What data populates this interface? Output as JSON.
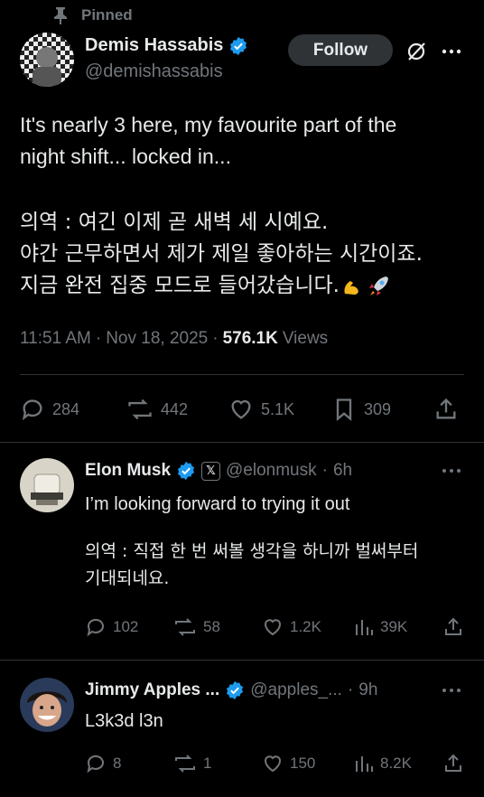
{
  "pinned": {
    "label": "Pinned"
  },
  "main_post": {
    "author_name": "Demis Hassabis",
    "author_handle": "@demishassabis",
    "follow_label": "Follow",
    "text_lines": [
      "It's nearly 3 here, my favourite part of the",
      "night shift... locked in..."
    ],
    "translation_lines": [
      "의역 : 여긴 이제 곧 새벽 세 시예요.",
      "야간 근무하면서 제가 제일 좋아하는 시간이죠.",
      "지금 완전 집중 모드로 들어갔습니다."
    ],
    "time": "11:51 AM",
    "date": "Nov 18, 2025",
    "views_count": "576.1K",
    "views_label": "Views",
    "replies": "284",
    "reposts": "442",
    "likes": "5.1K",
    "bookmarks": "309"
  },
  "replies": [
    {
      "author_name": "Elon Musk",
      "author_handle": "@elonmusk",
      "age": "6h",
      "text": "I’m looking forward to trying it out",
      "translation_lines": [
        "의역 : 직접 한 번 써볼 생각을 하니까 벌써부터",
        "기대되네요."
      ],
      "replies": "102",
      "reposts": "58",
      "likes": "1.2K",
      "views": "39K"
    },
    {
      "author_name": "Jimmy Apples ...",
      "author_handle": "@apples_...",
      "age": "9h",
      "text": "L3k3d l3n",
      "replies": "8",
      "reposts": "1",
      "likes": "150",
      "views": "8.2K"
    }
  ],
  "colors": {
    "background": "#000000",
    "text": "#e7e9ea",
    "muted": "#71767b",
    "verified": "#1d9bf0",
    "divider": "#2f3336"
  }
}
